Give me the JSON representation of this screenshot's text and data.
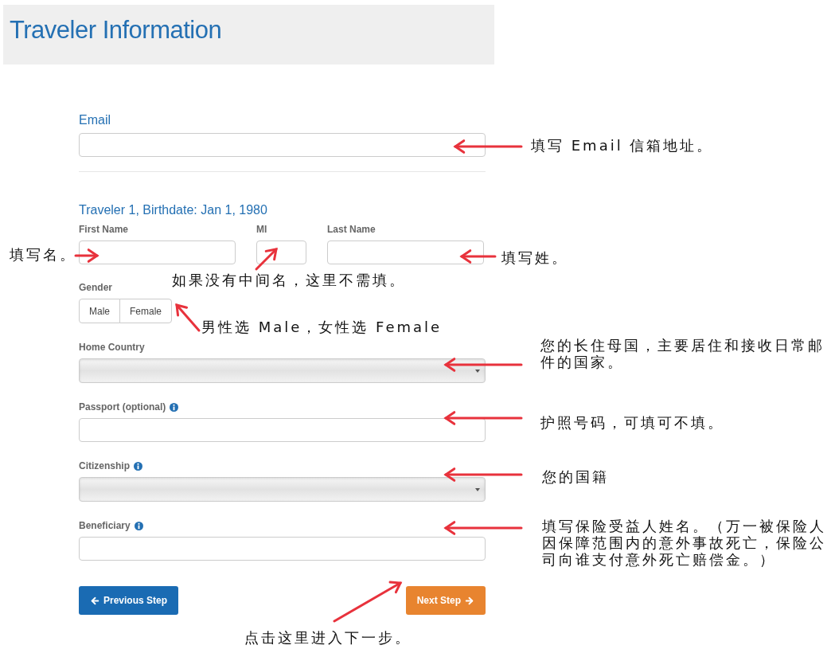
{
  "header": {
    "title": "Traveler Information"
  },
  "email": {
    "label": "Email"
  },
  "traveler": {
    "heading": "Traveler 1, Birthdate: Jan 1, 1980",
    "name_fields": [
      {
        "label": "First Name"
      },
      {
        "label": "MI"
      },
      {
        "label": "Last Name"
      }
    ],
    "gender": {
      "label": "Gender",
      "options": [
        {
          "label": "Male",
          "selected": false
        },
        {
          "label": "Female",
          "selected": false
        }
      ]
    },
    "fields": [
      {
        "label": "Home Country",
        "kind": "select",
        "info": false
      },
      {
        "label": "Passport (optional)",
        "kind": "text",
        "info": true
      },
      {
        "label": "Citizenship",
        "kind": "select",
        "info": true
      },
      {
        "label": "Beneficiary",
        "kind": "text",
        "info": true
      }
    ]
  },
  "buttons": {
    "previous": "Previous Step",
    "next": "Next Step"
  },
  "annotations": [
    "填写 Email 信箱地址。",
    "填写名。",
    "如果没有中间名，这里不需填。",
    "填写姓。",
    "男性选 Male，女性选 Female",
    "您的长住母国，主要居住和接收日常邮件的国家。",
    "护照号码，可填可不填。",
    "您的国籍",
    "填写保险受益人姓名。（万一被保险人因保障范围内的意外事故死亡，保险公司向谁支付意外死亡赔偿金。）",
    "点击这里进入下一步。"
  ]
}
